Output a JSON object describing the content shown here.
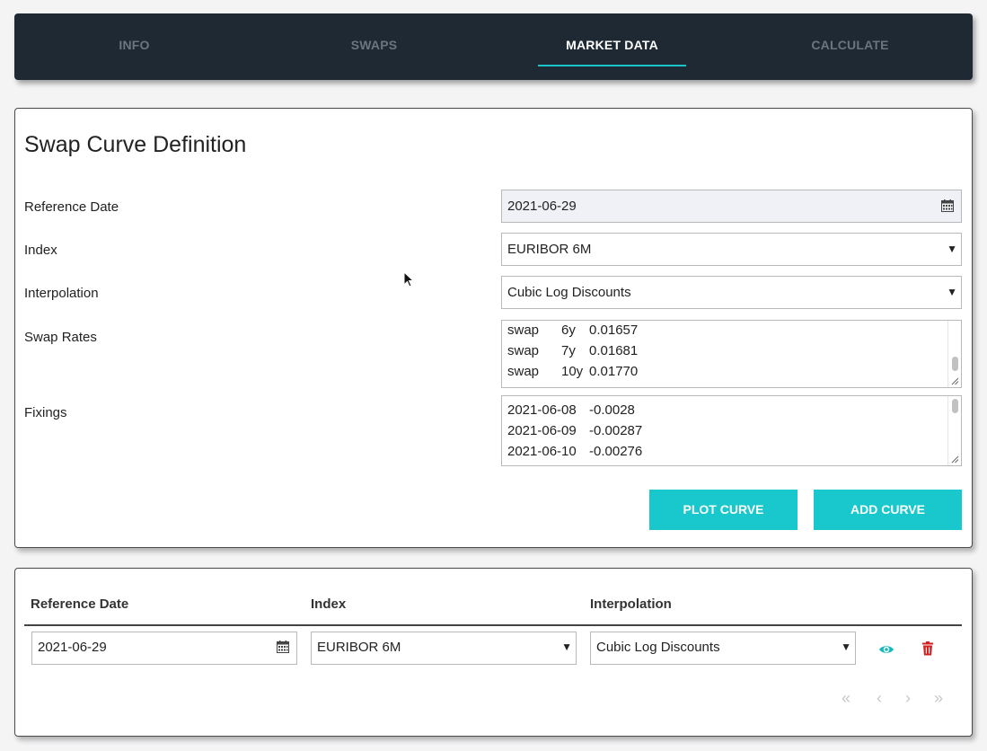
{
  "nav": {
    "tabs": [
      {
        "label": "INFO",
        "active": false
      },
      {
        "label": "SWAPS",
        "active": false
      },
      {
        "label": "MARKET DATA",
        "active": true
      },
      {
        "label": "CALCULATE",
        "active": false
      }
    ],
    "accent_color": "#18c4c8",
    "background_color": "#1f2933"
  },
  "curve_form": {
    "title": "Swap Curve Definition",
    "reference_date": {
      "label": "Reference Date",
      "value": "2021-06-29",
      "icon": "calendar-icon"
    },
    "index": {
      "label": "Index",
      "value": "EURIBOR 6M"
    },
    "interpolation": {
      "label": "Interpolation",
      "value": "Cubic Log Discounts"
    },
    "swap_rates": {
      "label": "Swap Rates",
      "rows": [
        {
          "type": "swap",
          "tenor": "6y",
          "rate": "0.01657"
        },
        {
          "type": "swap",
          "tenor": "7y",
          "rate": "0.01681"
        },
        {
          "type": "swap",
          "tenor": "10y",
          "rate": "0.01770"
        }
      ]
    },
    "fixings": {
      "label": "Fixings",
      "rows": [
        {
          "date": "2021-06-08",
          "value": "-0.0028"
        },
        {
          "date": "2021-06-09",
          "value": "-0.00287"
        },
        {
          "date": "2021-06-10",
          "value": "-0.00276"
        }
      ]
    },
    "plot_button": "PLOT CURVE",
    "add_button": "ADD CURVE",
    "button_color": "#18c8cc"
  },
  "curves_table": {
    "columns": [
      "Reference Date",
      "Index",
      "Interpolation"
    ],
    "rows": [
      {
        "reference_date": "2021-06-29",
        "index": "EURIBOR 6M",
        "interpolation": "Cubic Log Discounts",
        "view_icon": "eye-icon",
        "delete_icon": "trash-icon"
      }
    ],
    "pagination": {
      "first": "«",
      "prev": "‹",
      "next": "›",
      "last": "»"
    }
  }
}
